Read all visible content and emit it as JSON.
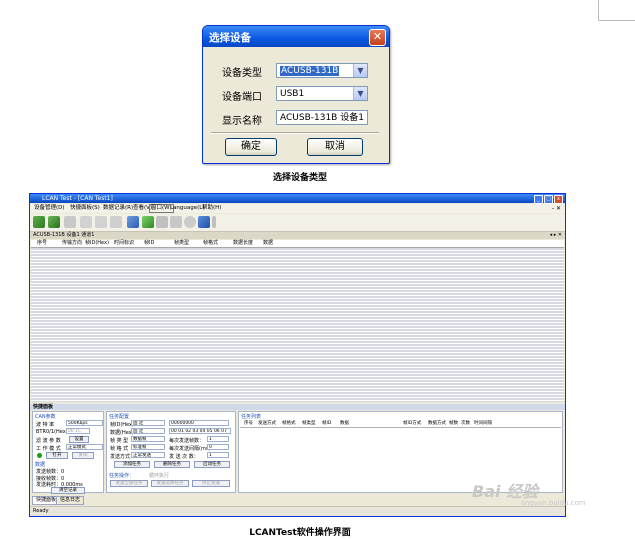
{
  "dialog": {
    "title": "选择设备",
    "close_glyph": "✕",
    "device_type_label": "设备类型",
    "device_type_value": "ACUSB-131B",
    "device_port_label": "设备端口",
    "device_port_value": "USB1",
    "display_name_label": "显示名称",
    "display_name_value": "ACUSB-131B 设备1",
    "ok_label": "确定",
    "cancel_label": "取消",
    "dropdown_glyph": "▼"
  },
  "caption_top": "选择设备类型",
  "app": {
    "title": "LCAN Test - [CAN Test1]",
    "menu": [
      "设备管理(D)",
      "快捷面板(S)",
      "数据记录(R)",
      "查看(V)",
      "窗口(W)",
      "Language(L)",
      "帮助(H)"
    ],
    "menu_right": "- ✕",
    "device_tab": "ACUSB-131B 设备1 通道1",
    "device_tab_right": "◂ ▸ ✕",
    "columns": [
      "序号",
      "传输方向",
      "帧ID(Hex)",
      "时间标识",
      "帧ID",
      "帧类型",
      "帧格式",
      "数据长度",
      "数据"
    ],
    "send_title": "快捷面板",
    "can_panel": {
      "header": "CAN参数",
      "baud_label": "波 特 率",
      "baud_value": "500Kbps",
      "btr_label": "BTR0/1(Hex)",
      "btr_value": "00 1C",
      "filter_label": "滤 波 参 数",
      "filter_button": "设置",
      "mode_label": "工 作 模 式",
      "mode_value": "正常模式",
      "open_button": "打开",
      "close_button": "关闭",
      "stats_header": "数据",
      "sent_label": "发送帧数：0",
      "recv_label": "接收帧数：0",
      "time_label": "发送耗时：0.000ms",
      "clear_button": "清空记录"
    },
    "task_panel": {
      "header": "任务配置",
      "id_label": "帧ID(Hex)",
      "id_type": "固 定",
      "id_value": "00000000",
      "data_label": "数据(Hex)",
      "data_type": "固 定",
      "data_value": "00 01 02 03 04 05 06 07",
      "frame_type_label": "帧 类 型",
      "frame_type_value": "数据帧",
      "frame_format_label": "帧 格 式",
      "frame_format_value": "标准帧",
      "send_mode_label": "发送方式",
      "send_mode_value": "正常发送",
      "count_label": "每次发送帧数：",
      "count_value": "1",
      "interval_label": "每次发送间隔(ms)：",
      "interval_value": "0",
      "repeat_label": "发 送 次 数：",
      "repeat_value": "1",
      "add_button": "添加任务",
      "delete_button": "删除任务",
      "start_button": "启动任务",
      "op_header": "任务操作：",
      "loop_label": "循环执行",
      "op_btn1": "发送全部任务",
      "op_btn2": "发送选择任务",
      "op_btn3": "停止发送"
    },
    "task_list": {
      "header": "任务列表",
      "columns": [
        "序号",
        "发送方式",
        "帧格式",
        "帧类型",
        "帧ID",
        "数据",
        "帧ID方式",
        "数据方式",
        "帧数",
        "次数",
        "时间间隔"
      ]
    },
    "bottom_tabs": [
      "快捷面板",
      "信息日志"
    ],
    "status": "Ready"
  },
  "caption_bottom": "LCANTest软件操作界面",
  "watermark": "Bai 经验",
  "watermark_sub": "jingyan.baidu.com"
}
